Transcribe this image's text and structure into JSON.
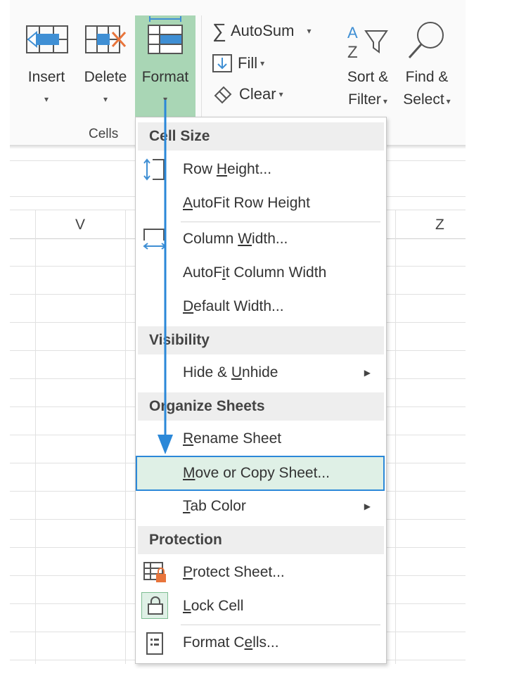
{
  "ribbon": {
    "insert": {
      "label": "Insert",
      "arrow": "▾"
    },
    "delete": {
      "label": "Delete",
      "arrow": "▾"
    },
    "format": {
      "label": "Format",
      "arrow": "▾"
    },
    "cells_group": "Cells",
    "autosum": {
      "label": "AutoSum",
      "arrow": "▾",
      "symbol": "∑"
    },
    "fill": {
      "label": "Fill",
      "arrow": "▾"
    },
    "clear": {
      "label": "Clear",
      "arrow": "▾"
    },
    "sort_filter": {
      "line1": "Sort &",
      "line2": "Filter",
      "arrow": "▾"
    },
    "find_select": {
      "line1": "Find &",
      "line2": "Select",
      "arrow": "▾"
    }
  },
  "sheet": {
    "columns": [
      "V",
      "Z"
    ]
  },
  "menu": {
    "cell_size": "Cell Size",
    "row_height": {
      "pre": "Row ",
      "key": "H",
      "post": "eight..."
    },
    "autofit_row": {
      "pre": "",
      "key": "A",
      "post": "utoFit Row Height"
    },
    "column_width": {
      "pre": "Column ",
      "key": "W",
      "post": "idth..."
    },
    "autofit_col": {
      "pre": "AutoF",
      "key": "i",
      "post": "t Column Width"
    },
    "default_width": {
      "pre": "",
      "key": "D",
      "post": "efault Width..."
    },
    "visibility": "Visibility",
    "hide_unhide": {
      "pre": "Hide & ",
      "key": "U",
      "post": "nhide",
      "arrow": "▶"
    },
    "organize": "Organize Sheets",
    "rename": {
      "pre": "",
      "key": "R",
      "post": "ename Sheet"
    },
    "move_copy": {
      "pre": "",
      "key": "M",
      "post": "ove or Copy Sheet..."
    },
    "tab_color": {
      "pre": "",
      "key": "T",
      "post": "ab Color",
      "arrow": "▶"
    },
    "protection": "Protection",
    "protect_sheet": {
      "pre": "",
      "key": "P",
      "post": "rotect Sheet..."
    },
    "lock_cell": {
      "pre": "",
      "key": "L",
      "post": "ock Cell"
    },
    "format_cells": {
      "pre": "Format C",
      "key": "e",
      "post": "lls..."
    }
  },
  "colors": {
    "format_active": "#a9d6b5",
    "highlight_border": "#2b88d8",
    "highlight_fill": "#dff0e6",
    "annotation_arrow": "#2b88d8"
  }
}
